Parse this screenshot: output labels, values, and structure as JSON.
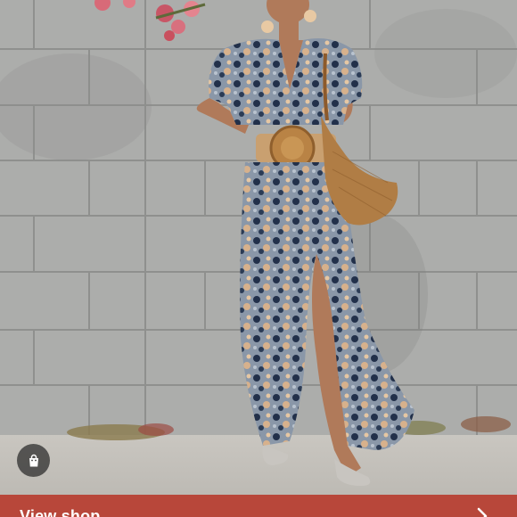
{
  "listing_photo": {
    "description_icon": "shopping-bag-icon"
  },
  "cta_bar": {
    "label": "View shop",
    "chevron_icon": "chevron-right-icon",
    "color": "#b8473a"
  }
}
